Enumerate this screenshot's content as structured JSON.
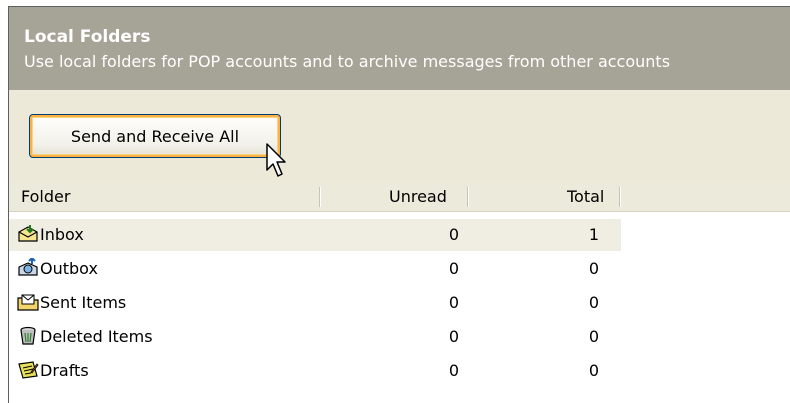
{
  "header": {
    "title": "Local Folders",
    "description": "Use local folders for POP accounts and to archive messages from other accounts"
  },
  "toolbar": {
    "send_receive_label": "Send and Receive All"
  },
  "table": {
    "columns": [
      "Folder",
      "Unread",
      "Total"
    ],
    "rows": [
      {
        "icon": "inbox-icon",
        "name": "Inbox",
        "unread": "0",
        "total": "1"
      },
      {
        "icon": "outbox-icon",
        "name": "Outbox",
        "unread": "0",
        "total": "0"
      },
      {
        "icon": "sent-items-icon",
        "name": "Sent Items",
        "unread": "0",
        "total": "0"
      },
      {
        "icon": "deleted-items-icon",
        "name": "Deleted Items",
        "unread": "0",
        "total": "0"
      },
      {
        "icon": "drafts-icon",
        "name": "Drafts",
        "unread": "0",
        "total": "0"
      }
    ],
    "selected_row": 0
  },
  "colors": {
    "header_bg": "#a6a397",
    "toolbar_bg": "#ece9d8",
    "button_focus": "#f8b341"
  }
}
